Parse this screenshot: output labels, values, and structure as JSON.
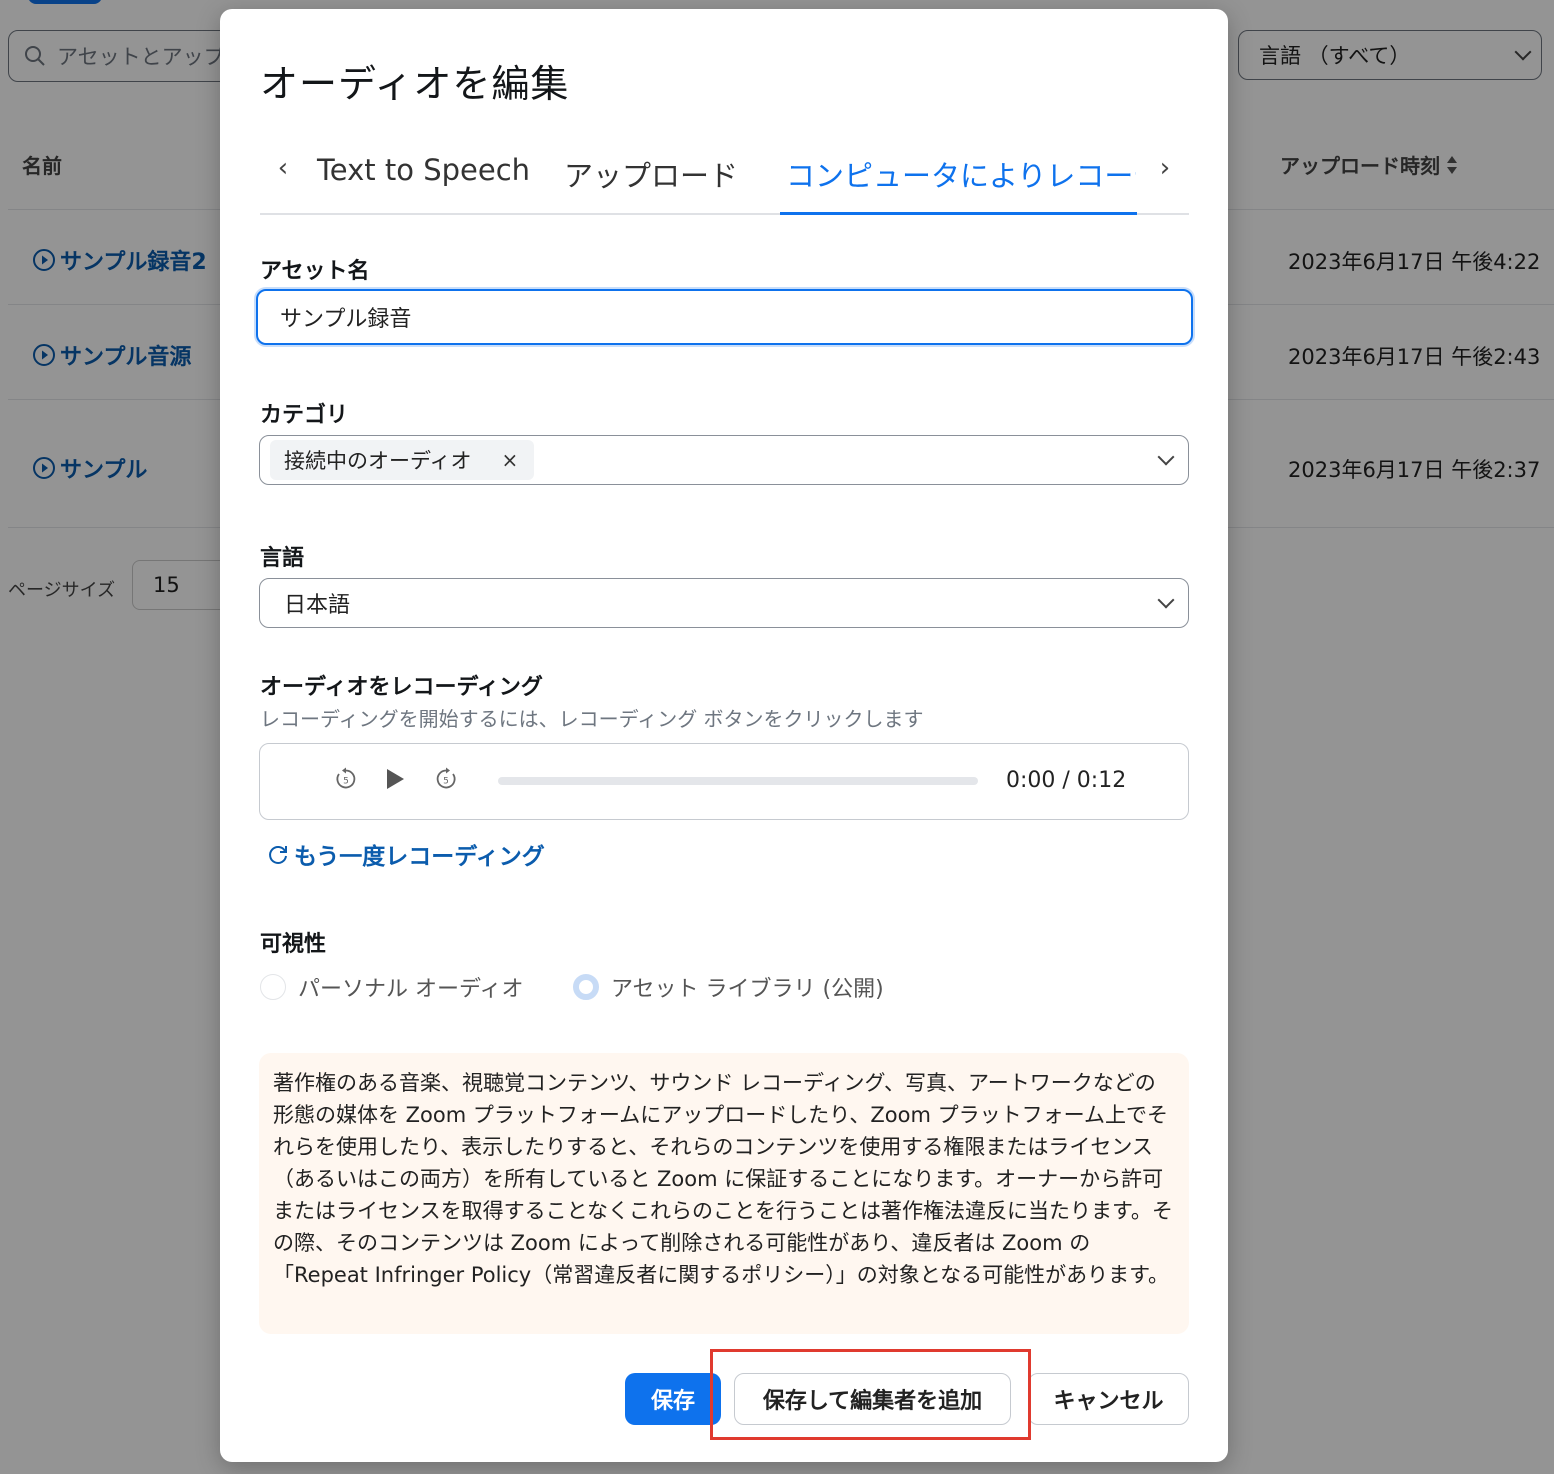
{
  "background": {
    "search_placeholder": "アセットとアップ",
    "language_filter": "言語 （すべて）",
    "column_name": "名前",
    "column_upload_time": "アップロード時刻",
    "rows": [
      {
        "name": "サンプル録音2",
        "time": "2023年6月17日 午後4:22"
      },
      {
        "name": "サンプル音源",
        "time": "2023年6月17日 午後2:43"
      },
      {
        "name": "サンプル",
        "time": "2023年6月17日 午後2:37"
      }
    ],
    "page_size_label": "ページサイズ",
    "page_size_value": "15"
  },
  "modal": {
    "title": "オーディオを編集",
    "tabs": [
      {
        "label": "Text to Speech",
        "active": false
      },
      {
        "label": "アップロード",
        "active": false
      },
      {
        "label": "コンピュータによりレコーディング",
        "active": true
      }
    ],
    "asset_name": {
      "label": "アセット名",
      "value": "サンプル録音"
    },
    "category": {
      "label": "カテゴリ",
      "chip": "接続中のオーディオ",
      "chip_remove": "×"
    },
    "language": {
      "label": "言語",
      "value": "日本語"
    },
    "recording": {
      "label": "オーディオをレコーディング",
      "hint": "レコーディングを開始するには、レコーディング ボタンをクリックします",
      "rewind_label": "5",
      "forward_label": "5",
      "time": "0:00 / 0:12",
      "progress": 0,
      "rerecord": "もう一度レコーディング"
    },
    "visibility": {
      "label": "可視性",
      "options": [
        {
          "label": "パーソナル オーディオ",
          "selected": false
        },
        {
          "label": "アセット ライブラリ (公開)",
          "selected": true
        }
      ]
    },
    "notice": "著作権のある音楽、視聴覚コンテンツ、サウンド レコーディング、写真、アートワークなどの形態の媒体を Zoom プラットフォームにアップロードしたり、Zoom プラットフォーム上でそれらを使用したり、表示したりすると、それらのコンテンツを使用する権限またはライセンス（あるいはこの両方）を所有していると Zoom に保証することになります。オーナーから許可またはライセンスを取得することなくこれらのことを行うことは著作権法違反に当たります。その際、そのコンテンツは Zoom によって削除される可能性があり、違反者は Zoom の「Repeat Infringer Policy（常習違反者に関するポリシー）」の対象となる可能性があります。",
    "buttons": {
      "save": "保存",
      "save_add_editor": "保存して編集者を追加",
      "cancel": "キャンセル"
    }
  },
  "colors": {
    "accent": "#0e72ed",
    "link": "#0b5cad",
    "highlight": "#e03a2f",
    "notice_bg": "#fff7f0"
  }
}
